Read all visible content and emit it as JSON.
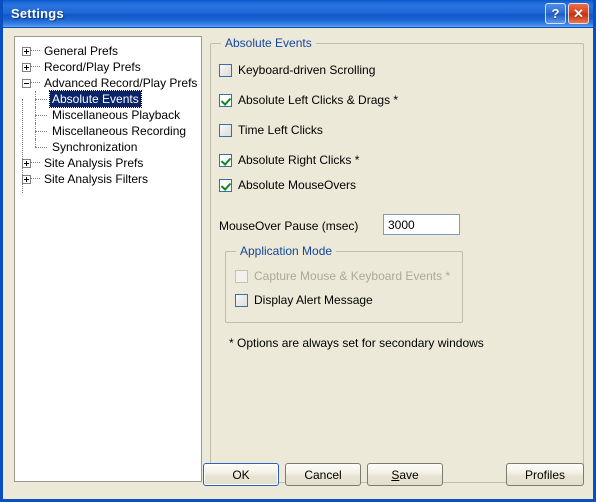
{
  "window": {
    "title": "Settings",
    "help_icon": "question-mark-icon",
    "close_icon": "close-x-icon",
    "help_label": "?",
    "close_label": "✕",
    "accent_titlebar": "#1f66d6",
    "dialog_background": "#ece9d8"
  },
  "tree": {
    "items": [
      {
        "label": "General Prefs",
        "level": 0,
        "state": "collapsed",
        "selected": false
      },
      {
        "label": "Record/Play Prefs",
        "level": 0,
        "state": "collapsed",
        "selected": false
      },
      {
        "label": "Advanced Record/Play Prefs",
        "level": 0,
        "state": "expanded",
        "selected": false
      },
      {
        "label": "Absolute Events",
        "level": 1,
        "state": "leaf",
        "selected": true
      },
      {
        "label": "Miscellaneous Playback",
        "level": 1,
        "state": "leaf",
        "selected": false
      },
      {
        "label": "Miscellaneous Recording",
        "level": 1,
        "state": "leaf",
        "selected": false
      },
      {
        "label": "Synchronization",
        "level": 1,
        "state": "leaf",
        "selected": false
      },
      {
        "label": "Site Analysis Prefs",
        "level": 0,
        "state": "collapsed",
        "selected": false
      },
      {
        "label": "Site Analysis Filters",
        "level": 0,
        "state": "collapsed",
        "selected": false
      }
    ]
  },
  "main_group": {
    "title": "Absolute Events",
    "title_color": "#14459e",
    "checkboxes": [
      {
        "label": "Keyboard-driven Scrolling",
        "checked": false,
        "enabled": true
      },
      {
        "label": "Absolute Left Clicks & Drags *",
        "checked": true,
        "enabled": true
      },
      {
        "label": "Time Left Clicks",
        "checked": false,
        "enabled": true
      },
      {
        "label": "Absolute Right Clicks *",
        "checked": true,
        "enabled": true
      },
      {
        "label": "Absolute MouseOvers",
        "checked": true,
        "enabled": true
      }
    ],
    "pause_field": {
      "label": "MouseOver Pause (msec)",
      "value": "3000",
      "placeholder": ""
    }
  },
  "app_mode_group": {
    "title": "Application Mode",
    "checkboxes": [
      {
        "label": "Capture Mouse & Keyboard Events *",
        "checked": false,
        "enabled": false
      },
      {
        "label": "Display Alert Message",
        "checked": false,
        "enabled": true
      }
    ]
  },
  "footnote": "* Options are always set for secondary windows",
  "buttons": {
    "ok": "OK",
    "cancel": "Cancel",
    "save_mnemonic": "S",
    "save_rest": "ave",
    "profiles": "Profiles"
  }
}
